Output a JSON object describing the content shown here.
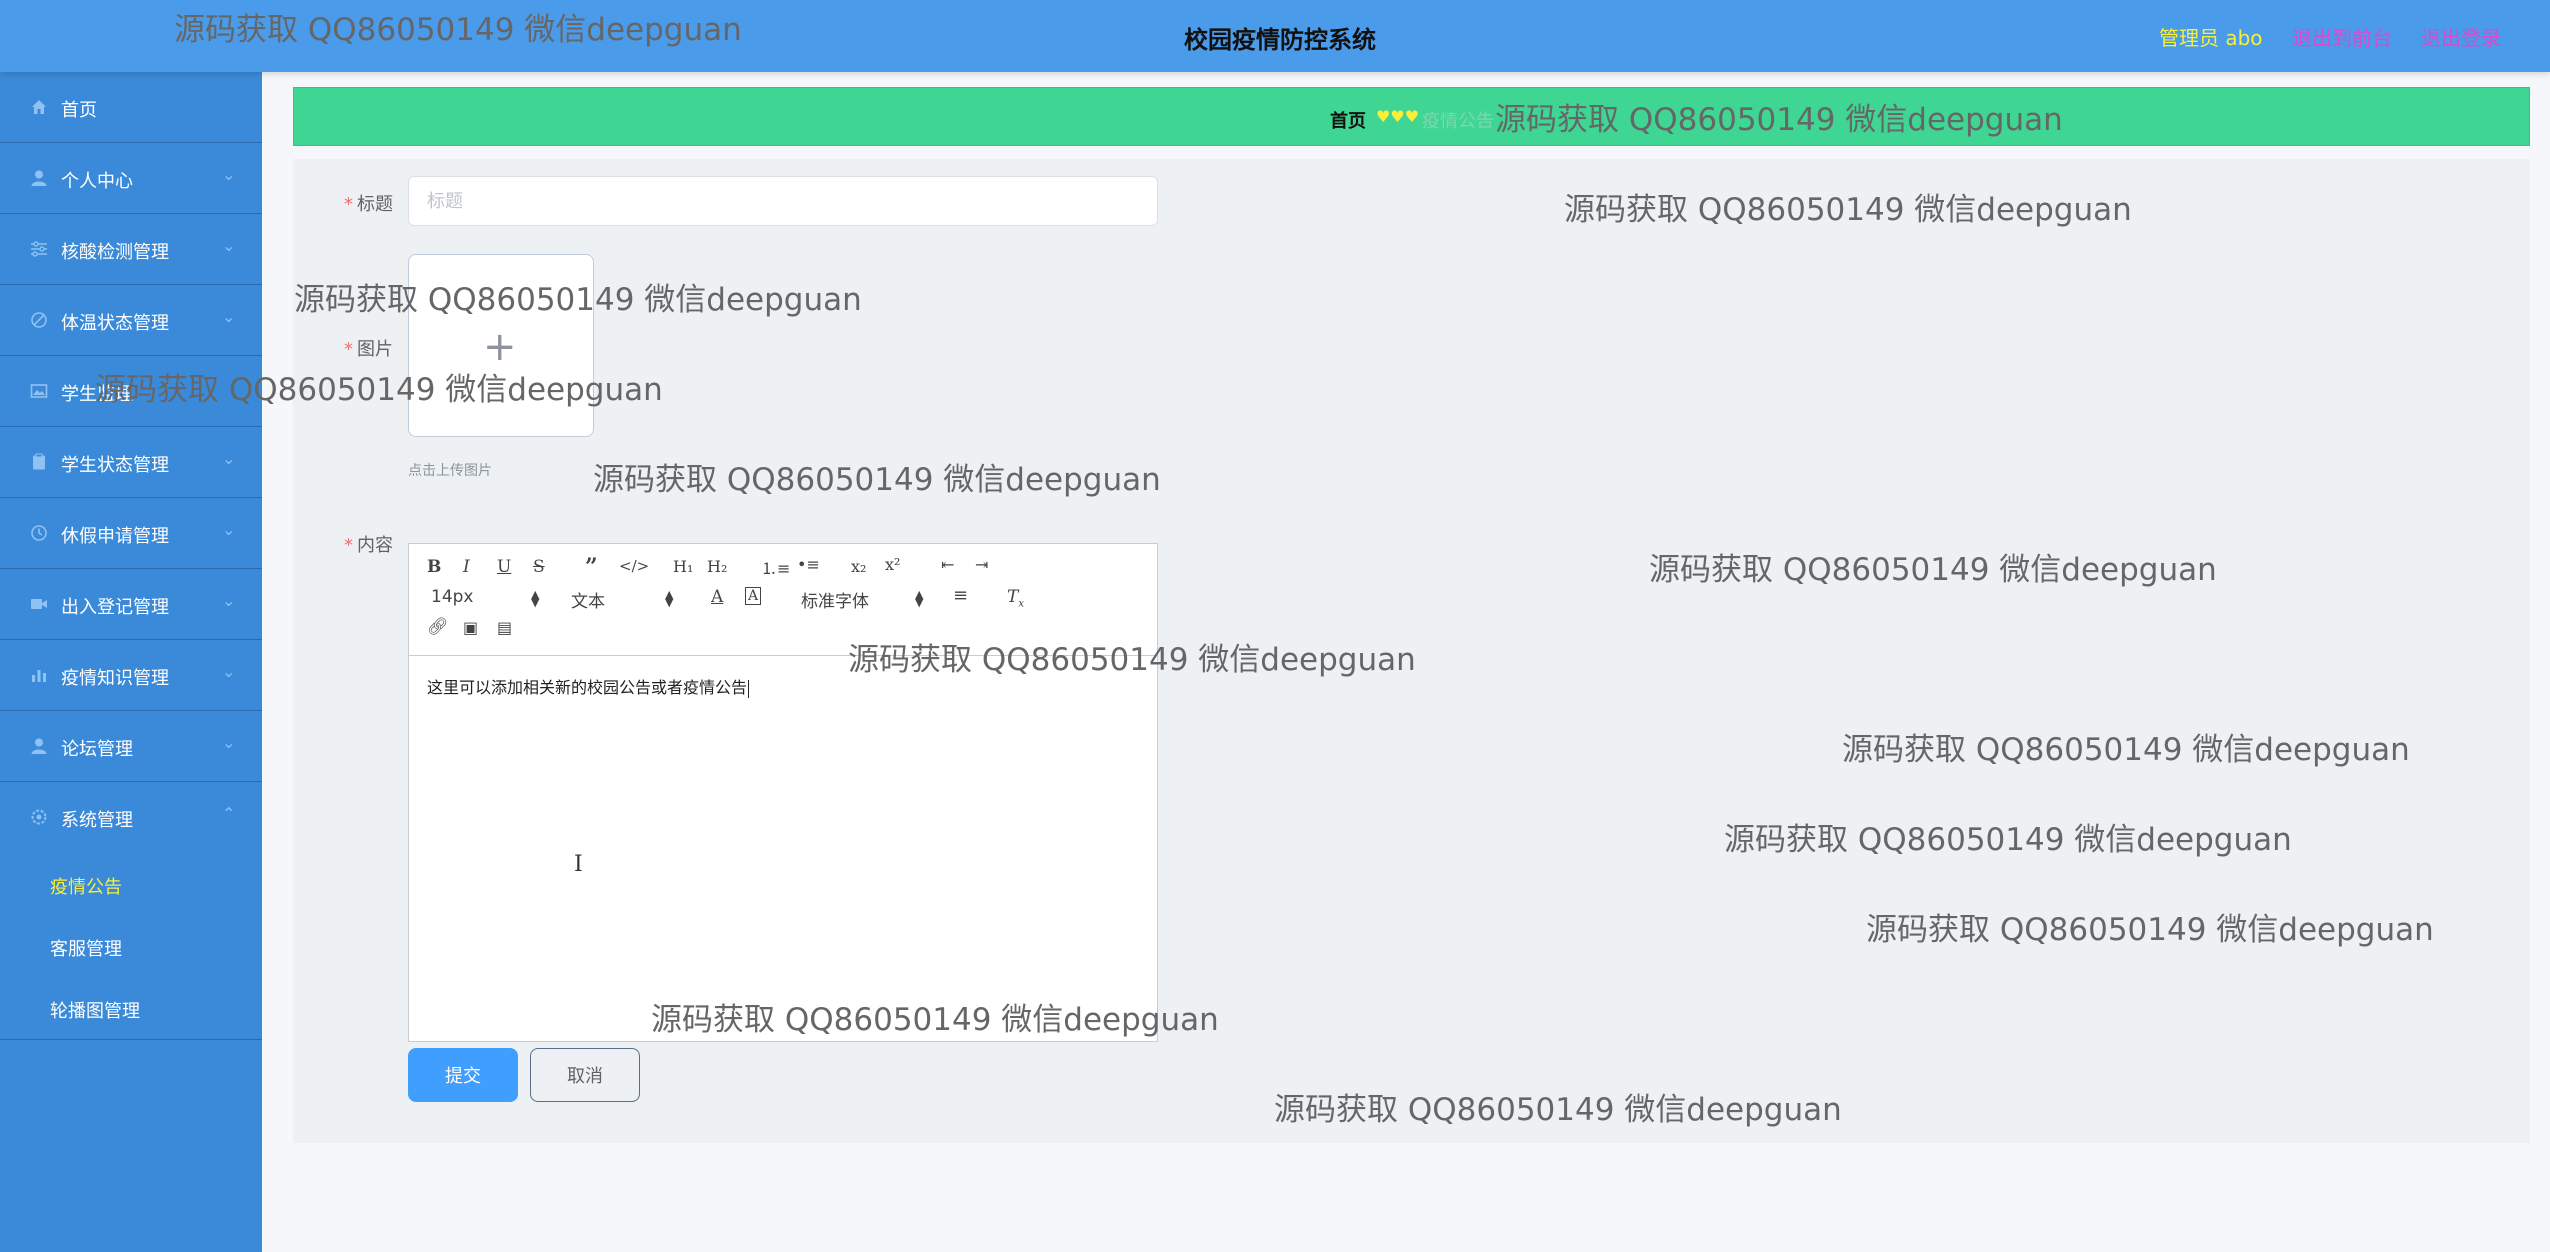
{
  "header": {
    "title": "校园疫情防控系统",
    "admin_label": "管理员 abo",
    "back_label": "退出到前台",
    "logout_label": "退出登录"
  },
  "sidebar": {
    "items": [
      {
        "label": "首页",
        "icon": "home-icon"
      },
      {
        "label": "个人中心",
        "icon": "user-icon"
      },
      {
        "label": "核酸检测管理",
        "icon": "sliders-icon"
      },
      {
        "label": "体温状态管理",
        "icon": "no-entry-icon"
      },
      {
        "label": "学生监理",
        "icon": "image-icon"
      },
      {
        "label": "学生状态管理",
        "icon": "clipboard-icon"
      },
      {
        "label": "休假申请管理",
        "icon": "clock-icon"
      },
      {
        "label": "出入登记管理",
        "icon": "camera-icon"
      },
      {
        "label": "疫情知识管理",
        "icon": "chart-icon"
      },
      {
        "label": "论坛管理",
        "icon": "user-icon"
      },
      {
        "label": "系统管理",
        "icon": "gear-icon"
      }
    ],
    "sub_items": [
      {
        "label": "疫情公告",
        "active": true
      },
      {
        "label": "客服管理",
        "active": false
      },
      {
        "label": "轮播图管理",
        "active": false
      }
    ]
  },
  "breadcrumb": {
    "home": "首页",
    "separator": "♥♥♥",
    "current": "疫情公告"
  },
  "form": {
    "title_label": "标题",
    "title_placeholder": "标题",
    "title_value": "",
    "image_label": "图片",
    "upload_hint": "点击上传图片",
    "content_label": "内容",
    "content_text": "这里可以添加相关新的校园公告或者疫情公告",
    "submit_label": "提交",
    "cancel_label": "取消"
  },
  "editor": {
    "font_size": "14px",
    "block_format": "文本",
    "font_family": "标准字体"
  },
  "watermark": {
    "text": "源码获取 QQ86050149 微信deepguan"
  },
  "colors": {
    "header_bg": "#4a9bea",
    "sidebar_bg": "#3a8ad9",
    "breadcrumb_bg": "#3fd694",
    "primary_button": "#409eff",
    "active_menu": "#f7ef3a"
  }
}
